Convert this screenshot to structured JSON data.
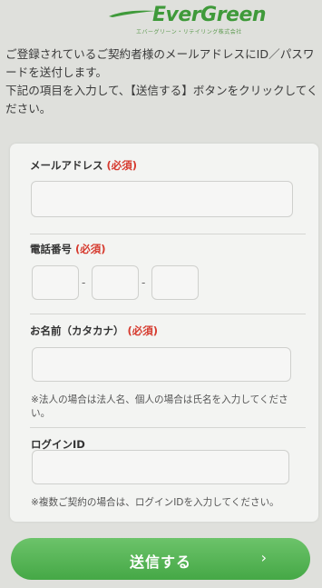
{
  "brand": {
    "name": "EverGreen",
    "tagline": "エバーグリーン・リテイリング株式会社",
    "color": "#3f9a3a"
  },
  "intro": {
    "line1": "ご登録されているご契約者様のメールアドレスにID／パスワードを送付します。",
    "line2": "下記の項目を入力して、【送信する】ボタンをクリックしてください。"
  },
  "form": {
    "email": {
      "label": "メールアドレス",
      "required": "(必須)",
      "value": ""
    },
    "phone": {
      "label": "電話番号",
      "required": "(必須)",
      "dash": "-",
      "part1": "",
      "part2": "",
      "part3": ""
    },
    "name_kana": {
      "label": "お名前（カタカナ）",
      "required": "(必須)",
      "value": "",
      "note": "※法人の場合は法人名、個人の場合は氏名を入力してください。"
    },
    "login_id": {
      "label": "ログインID",
      "value": "",
      "note": "※複数ご契約の場合は、ログインIDを入力してください。"
    }
  },
  "submit": {
    "label": "送信する",
    "icon": "chevron-right-icon",
    "arrow": "›"
  },
  "colors": {
    "background": "#dfe0dc",
    "card": "#f3f4f2",
    "required": "#d63a2e",
    "button": "#4caf4d"
  }
}
